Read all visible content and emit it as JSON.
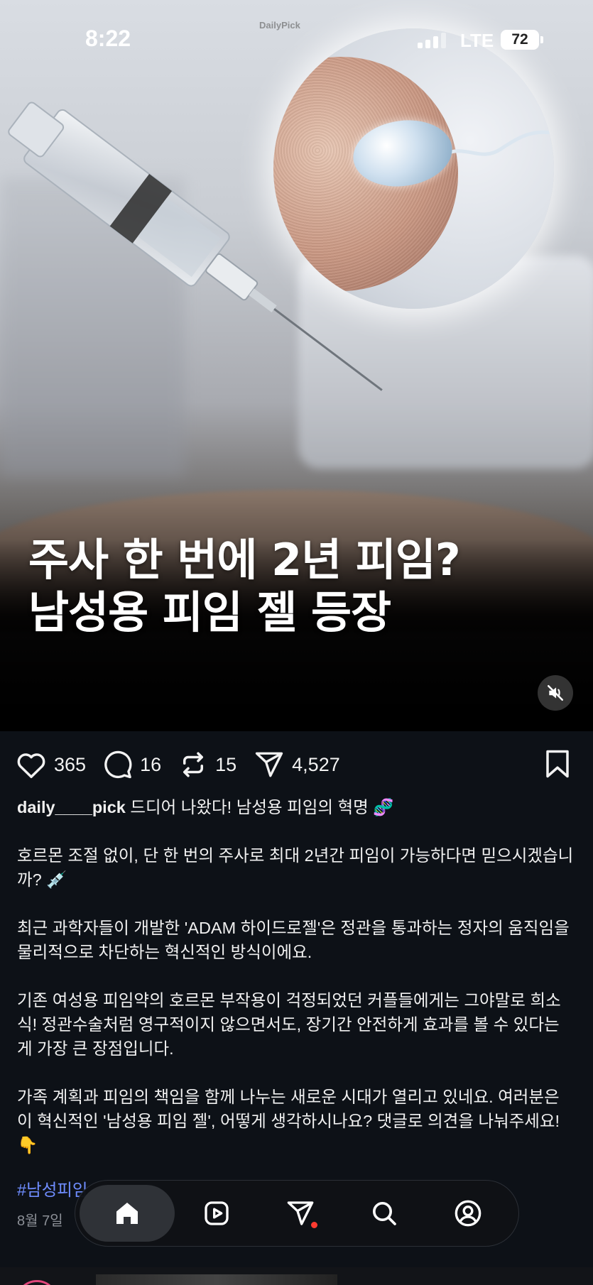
{
  "status_bar": {
    "time": "8:22",
    "network": "LTE",
    "battery": "72"
  },
  "media": {
    "watermark": "DailyPick",
    "headline_line1": "주사 한 번에 2년 피임?",
    "headline_line2": "남성용 피임 젤 등장",
    "mute_icon": "speaker-muted-icon"
  },
  "actions": {
    "likes": "365",
    "comments": "16",
    "reposts": "15",
    "shares": "4,527"
  },
  "post": {
    "username": "daily____pick",
    "intro": "드디어 나왔다! 남성용 피임의 혁명 🧬",
    "para1": "호르몬 조절 없이, 단 한 번의 주사로 최대 2년간 피임이 가능하다면 믿으시겠습니까? 💉",
    "para2": "최근 과학자들이 개발한 'ADAM 하이드로젤'은 정관을 통과하는 정자의 움직임을 물리적으로 차단하는 혁신적인 방식이에요.",
    "para3": "기존 여성용 피임약의 호르몬 부작용이 걱정되었던 커플들에게는 그야말로 희소식! 정관수술처럼 영구적이지 않으면서도, 장기간 안전하게 효과를 볼 수 있다는 게 가장 큰 장점입니다.",
    "para4": "가족 계획과 피임의 책임을 함께 나누는 새로운 시대가 열리고 있네요. 여러분은 이 혁신적인 '남성용 피임 젤', 어떻게 생각하시나요? 댓글로 의견을 나눠주세요! 👇",
    "hashtag": "#남성피임",
    "date": "8월 7일"
  },
  "nav": {
    "items": [
      "home-icon",
      "reels-icon",
      "send-icon",
      "search-icon",
      "profile-icon"
    ],
    "active": "home"
  },
  "colors": {
    "background": "#0d1117",
    "hashtag": "#6f8dff",
    "notification_dot": "#ff3b30"
  }
}
